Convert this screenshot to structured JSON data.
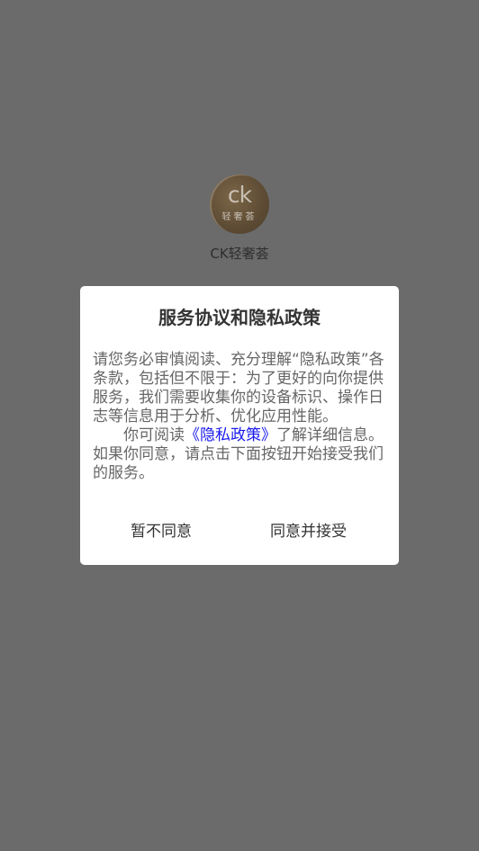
{
  "app": {
    "name": "CK轻奢荟",
    "logo_mark": "ck",
    "logo_sub": "轻奢荟"
  },
  "dialog": {
    "title": "服务协议和隐私政策",
    "paragraph1": "请您务必审慎阅读、充分理解“隐私政策”各条款，包括但不限于：为了更好的向你提供服务，我们需要收集你的设备标识、操作日志等信息用于分析、优化应用性能。",
    "paragraph2_before": "你可阅读",
    "privacy_link": "《隐私政策》",
    "paragraph2_after": "了解详细信息。如果你同意，请点击下面按钮开始接受我们的服务。",
    "decline_label": "暂不同意",
    "accept_label": "同意并接受"
  },
  "colors": {
    "overlay": "#6b6b6b",
    "dialog_bg": "#ffffff",
    "link": "#1a1aee",
    "title_text": "#333333",
    "body_text": "#666666"
  }
}
